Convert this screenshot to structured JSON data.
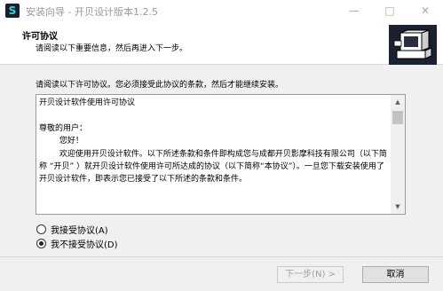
{
  "window": {
    "icon_letter": "S",
    "title": "安装向导 - 开贝设计版本1.2.5",
    "minimize": "—",
    "maximize": "□",
    "close": "✕"
  },
  "header": {
    "title": "许可协议",
    "subtitle": "请阅读以下重要信息，然后再进入下一步。"
  },
  "intro": "请阅读以下许可协议。您必须接受此协议的条款，然后才能继续安装。",
  "license": {
    "lines": [
      "开贝设计软件使用许可协议",
      "",
      "尊敬的用户：",
      "        您好！",
      "        欢迎使用开贝设计软件。以下所述条款和条件即构成您与成都开贝影摩科技有限公司（以下简称 “开贝” ）就开贝设计软件使用许可所达成的协议（以下简称“本协议”）。一旦您下载安装使用了开贝设计软件，即表示您已接受了以下所述的条款和条件。"
    ]
  },
  "radios": [
    {
      "label": "我接受协议(A)",
      "checked": false
    },
    {
      "label": "我不接受协议(D)",
      "checked": true
    }
  ],
  "buttons": {
    "next": "下一步(N) >",
    "cancel": "取消"
  }
}
